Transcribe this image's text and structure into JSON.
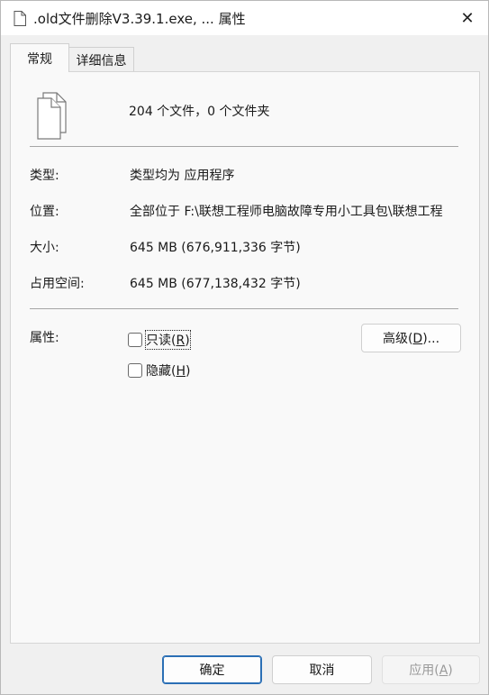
{
  "titlebar": {
    "title": ".old文件删除V3.39.1.exe, ... 属性",
    "icon": "file-icon",
    "close_glyph": "✕"
  },
  "tabs": [
    {
      "label": "常规",
      "active": true
    },
    {
      "label": "详细信息",
      "active": false
    }
  ],
  "general": {
    "summary": "204 个文件，0 个文件夹",
    "icon": "multiple-files-icon",
    "rows": [
      {
        "label": "类型:",
        "value": "类型均为 应用程序"
      },
      {
        "label": "位置:",
        "value": "全部位于 F:\\联想工程师电脑故障专用小工具包\\联想工程"
      },
      {
        "label": "大小:",
        "value": "645 MB (676,911,336 字节)"
      },
      {
        "label": "占用空间:",
        "value": "645 MB (677,138,432 字节)"
      }
    ],
    "attributes_label": "属性:",
    "readonly": {
      "text": "只读",
      "key": "R",
      "checked": false
    },
    "hidden": {
      "text": "隐藏",
      "key": "H",
      "checked": false
    },
    "advanced_button": {
      "text": "高级",
      "key": "D",
      "suffix": "..."
    }
  },
  "footer": {
    "ok": "确定",
    "cancel": "取消",
    "apply": {
      "text": "应用",
      "key": "A",
      "disabled": true
    }
  },
  "colors": {
    "primary_border": "#2b6fb5",
    "panel_bg": "#f9f9f9",
    "window_bg": "#f0f0f0"
  }
}
